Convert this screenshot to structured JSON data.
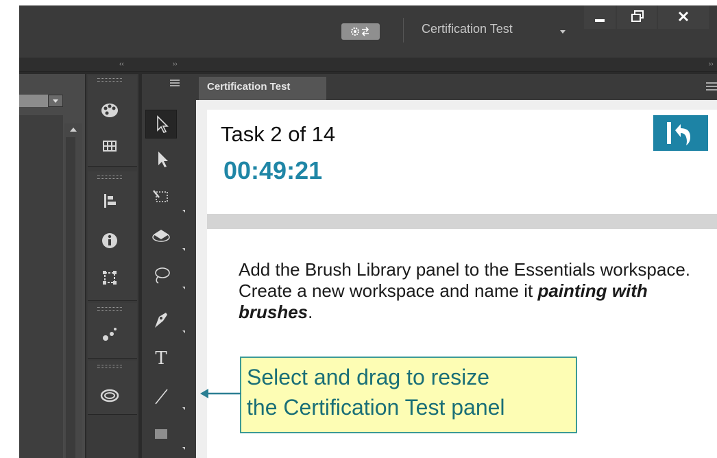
{
  "titlebar": {
    "workspace_label": "Certification Test",
    "gear_icon": "gear-arrows-icon",
    "window_buttons": [
      "minimize-icon",
      "restore-icon",
      "close-icon"
    ]
  },
  "panel": {
    "tab_label": "Certification Test",
    "task_label": "Task 2 of 14",
    "timer": "00:49:21",
    "back_icon": "return-arrow-icon",
    "instruction_pre": "Add the Brush Library panel to the Essentials workspace. Create a new workspace and name it ",
    "instruction_emph": "painting with brushes",
    "instruction_post": "."
  },
  "callout": {
    "text_line1": "Select and drag to resize",
    "text_line2": "the Certification Test panel"
  },
  "dock_icons": [
    "palette-icon",
    "grid-icon",
    "align-icon",
    "info-icon",
    "transform-icon",
    "brush-dots-icon",
    "creative-cloud-icon"
  ],
  "tool_icons": [
    "selection-tool-icon",
    "direct-selection-tool-icon",
    "magic-wand-tool-icon",
    "3d-rotate-tool-icon",
    "lasso-tool-icon",
    "pen-tool-icon",
    "type-tool-icon",
    "line-tool-icon",
    "rectangle-tool-icon"
  ],
  "colors": {
    "accent": "#1d83a5",
    "callout_bg": "#fdfdb4",
    "callout_text": "#1a6f77",
    "chrome_dark": "#3a3a3a"
  }
}
